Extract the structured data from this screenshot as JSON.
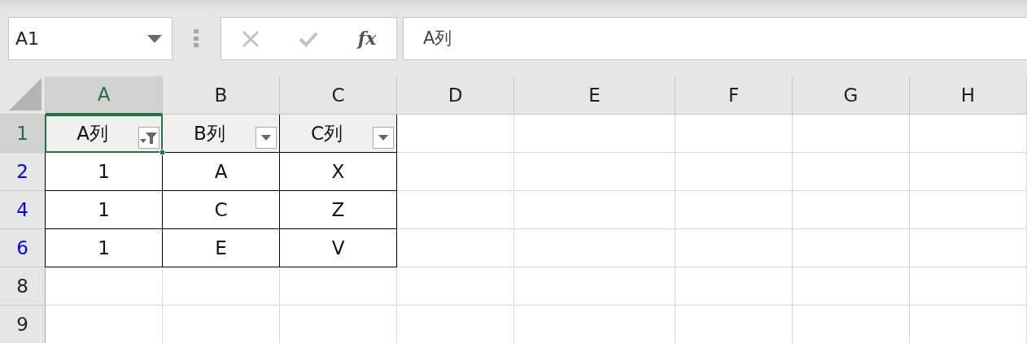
{
  "name_box": {
    "value": "A1"
  },
  "formula_buttons": [
    {
      "kind": "cancel",
      "disabled": true
    },
    {
      "kind": "enter",
      "disabled": true
    },
    {
      "kind": "function",
      "label": "fx",
      "disabled": false
    }
  ],
  "formula_bar": {
    "value": "A列"
  },
  "columns": [
    {
      "label": "A",
      "selected": true
    },
    {
      "label": "B",
      "selected": false
    },
    {
      "label": "C",
      "selected": false
    },
    {
      "label": "D",
      "selected": false
    },
    {
      "label": "E",
      "selected": false
    },
    {
      "label": "F",
      "selected": false
    },
    {
      "label": "G",
      "selected": false
    },
    {
      "label": "H",
      "selected": false
    }
  ],
  "rows": [
    {
      "number": "1",
      "selected": true,
      "filtered": false,
      "cells": [
        {
          "kind": "header",
          "text": "A列",
          "filter_active": true,
          "selected": true
        },
        {
          "kind": "header",
          "text": "B列",
          "filter_active": false,
          "selected": false
        },
        {
          "kind": "header",
          "text": "C列",
          "filter_active": false,
          "selected": false
        }
      ]
    },
    {
      "number": "2",
      "selected": false,
      "filtered": true,
      "cells": [
        {
          "kind": "data",
          "text": "1"
        },
        {
          "kind": "data",
          "text": "A"
        },
        {
          "kind": "data",
          "text": "X"
        }
      ]
    },
    {
      "number": "4",
      "selected": false,
      "filtered": true,
      "cells": [
        {
          "kind": "data",
          "text": "1"
        },
        {
          "kind": "data",
          "text": "C"
        },
        {
          "kind": "data",
          "text": "Z"
        }
      ]
    },
    {
      "number": "6",
      "selected": false,
      "filtered": true,
      "cells": [
        {
          "kind": "data",
          "text": "1"
        },
        {
          "kind": "data",
          "text": "E"
        },
        {
          "kind": "data",
          "text": "V"
        }
      ]
    },
    {
      "number": "8",
      "selected": false,
      "filtered": false,
      "cells": []
    },
    {
      "number": "9",
      "selected": false,
      "filtered": false,
      "cells": []
    }
  ]
}
